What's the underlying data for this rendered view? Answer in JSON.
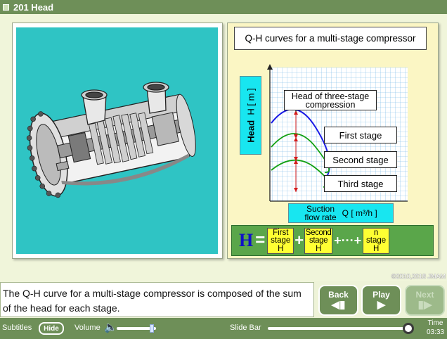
{
  "title": "201  Head",
  "chart": {
    "title": "Q-H curves for a multi-stage compressor",
    "callout": [
      "Head of three-stage",
      "compression"
    ],
    "stage_labels": [
      "First stage",
      "Second stage",
      "Third stage"
    ],
    "y_axis": [
      "Head",
      "H [ m ]"
    ],
    "x_axis": [
      "Suction",
      "flow rate",
      "Q [ m³/h ]"
    ],
    "formula": {
      "symbol": "H",
      "equals": "=",
      "plus": "+",
      "ellipsis": "+···+",
      "terms": [
        [
          "First",
          "stage",
          "H"
        ],
        [
          "Second",
          "stage",
          "H"
        ],
        [
          "n",
          "stage",
          "H"
        ]
      ]
    }
  },
  "copyright": "©2010,2018 JMAM",
  "subtitle": "The Q-H curve for a multi-stage compressor is composed of the sum of the head for each stage.",
  "nav": {
    "back": "Back",
    "play": "Play",
    "next": "Next"
  },
  "bottombar": {
    "subtitles_label": "Subtitles",
    "hide_label": "Hide",
    "volume_label": "Volume",
    "slidebar_label": "Slide Bar",
    "time_label": "Time",
    "time_value": "03:33",
    "volume_level": 0.9,
    "slide_position": 1.0
  },
  "colors": {
    "accent_green": "#6e8f58",
    "teal": "#2fc4c4",
    "cyan_label": "#18e6f0",
    "formula_bg": "#5aa64a",
    "term_yellow": "#ffff33",
    "curve_blue": "#1a1ae6",
    "curve_green": "#12a012",
    "marker_red": "#d41a1a"
  },
  "icons": [
    "speaker-icon",
    "back-arrow-icon",
    "play-arrow-icon",
    "next-arrow-icon"
  ]
}
